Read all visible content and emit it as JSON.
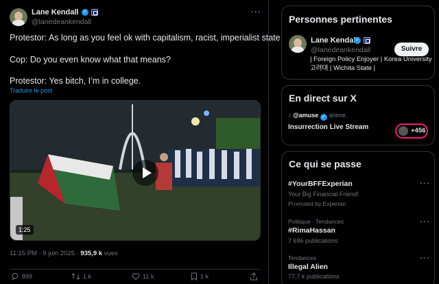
{
  "post": {
    "author_name": "Lane Kendall",
    "author_handle": "@lanedeankendall",
    "lines": [
      "Protestor: As long as you feel ok with capitalism, racist, imperialist state.",
      "Cop: Do you even know what that means?",
      "Protestor: Yes bitch, I’m in college."
    ],
    "translate": "Traduire le post",
    "video_duration": "1:25",
    "time": "11:15 PM · 9 juin 2025 ·",
    "views_count": "935,9 k",
    "views_label": "vues",
    "actions": {
      "replies": "899",
      "reposts": "1 k",
      "likes": "11 k",
      "bookmarks": "1 k"
    }
  },
  "sidebar": {
    "relevant": {
      "title": "Personnes pertinentes",
      "name": "Lane Kendall",
      "handle": "@lanedeankendall",
      "follow_label": "Suivre",
      "bio": "| Foreign Policy Enjoyer | Korea University 고려대 | Wichita State |"
    },
    "live": {
      "title": "En direct sur X",
      "user": "@amuse",
      "user_status": "anime.",
      "stream_title": "Insurrection Live Stream",
      "listeners": "+456"
    },
    "trends": {
      "title": "Ce qui se passe",
      "items": [
        {
          "context": "",
          "name": "#YourBFFExperian",
          "sub": "Your Big Financial Friend!",
          "promo": "Promoted by Experian"
        },
        {
          "context": "Politique · Tendances",
          "name": "#RimaHassan",
          "sub": "7 696 publications",
          "promo": ""
        },
        {
          "context": "Tendances",
          "name": "Illegal Alien",
          "sub": "77,7 k publications",
          "promo": ""
        }
      ]
    }
  },
  "colors": {
    "background": "#000000",
    "accent": "#1d9bf0",
    "live_ring": "#f91880",
    "muted": "#71767b"
  }
}
